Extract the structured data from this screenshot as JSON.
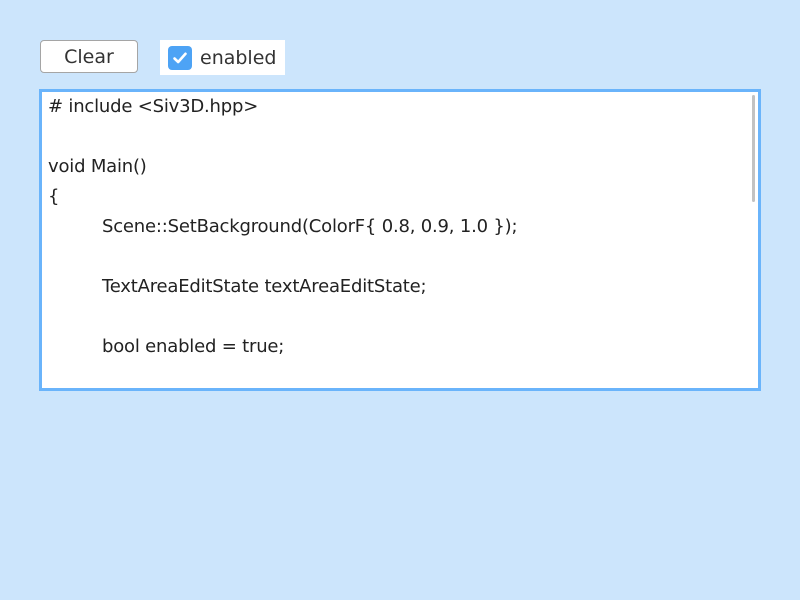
{
  "toolbar": {
    "clear_label": "Clear",
    "enabled_label": "enabled",
    "enabled_checked": true
  },
  "editor": {
    "lines": [
      "# include <Siv3D.hpp>",
      "",
      "void Main()",
      "{",
      "Scene::SetBackground(ColorF{ 0.8, 0.9, 1.0 });",
      "",
      "TextAreaEditState textAreaEditState;",
      "",
      "bool enabled = true;"
    ]
  },
  "colors": {
    "background": "#cce5fc",
    "accent": "#4da3f5",
    "focus_border": "#6ab4fb"
  }
}
